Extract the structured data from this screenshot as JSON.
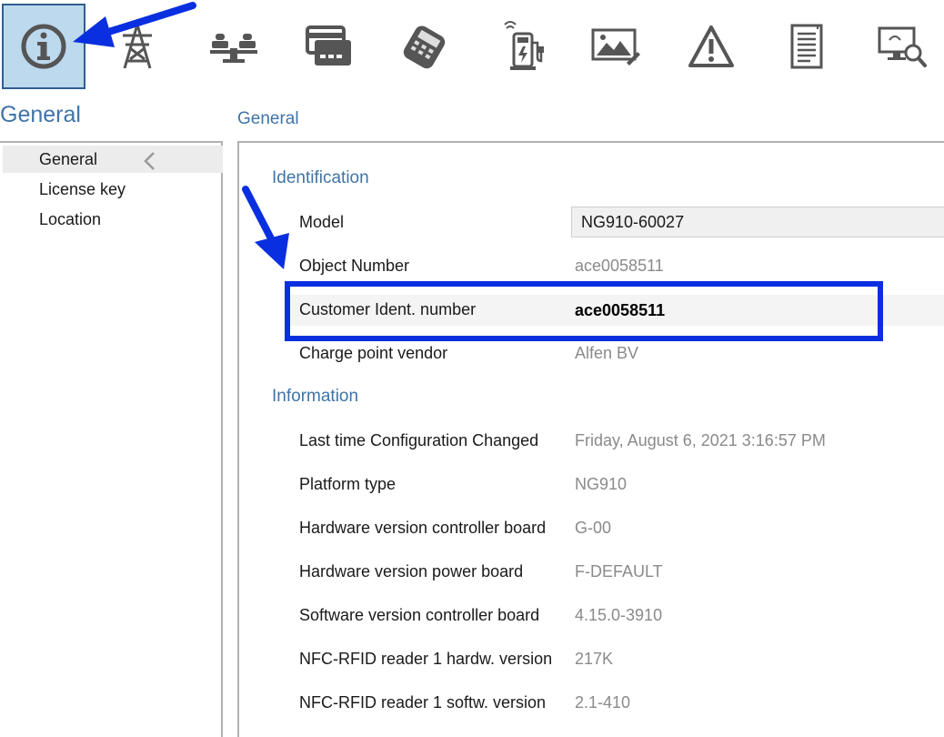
{
  "toolbar": {
    "buttons": [
      {
        "icon": "info-icon",
        "active": true
      },
      {
        "icon": "power-pylon-icon"
      },
      {
        "icon": "balance-scale-icon"
      },
      {
        "icon": "payment-card-icon"
      },
      {
        "icon": "card-terminal-icon"
      },
      {
        "icon": "charging-station-icon"
      },
      {
        "icon": "image-edit-icon"
      },
      {
        "icon": "warning-icon"
      },
      {
        "icon": "document-icon"
      },
      {
        "icon": "monitor-search-icon"
      }
    ]
  },
  "section_title": "General",
  "page_title": "General",
  "sidebar": {
    "items": [
      {
        "label": "General",
        "selected": true
      },
      {
        "label": "License key"
      },
      {
        "label": "Location"
      }
    ]
  },
  "identification": {
    "heading": "Identification",
    "model_label": "Model",
    "model_value": "NG910-60027",
    "object_number_label": "Object Number",
    "object_number_value": "ace0058511",
    "customer_ident_label": "Customer Ident. number",
    "customer_ident_value": "ace0058511",
    "vendor_label": "Charge point vendor",
    "vendor_value": "Alfen BV"
  },
  "information": {
    "heading": "Information",
    "rows": [
      {
        "label": "Last time Configuration Changed",
        "value": "Friday, August 6, 2021 3:16:57 PM"
      },
      {
        "label": "Platform type",
        "value": "NG910"
      },
      {
        "label": "Hardware version controller board",
        "value": "G-00"
      },
      {
        "label": "Hardware version power board",
        "value": "F-DEFAULT"
      },
      {
        "label": "Software version controller board",
        "value": "4.15.0-3910"
      },
      {
        "label": "NFC-RFID reader 1 hardw. version",
        "value": "217K"
      },
      {
        "label": "NFC-RFID reader 1 softw. version",
        "value": "2.1-410"
      }
    ]
  },
  "colors": {
    "accent": "#3f74a8",
    "active_button_bg": "#bcd9ee",
    "annotation_blue": "#0a2fe0",
    "muted_value": "#8a8a8a"
  }
}
